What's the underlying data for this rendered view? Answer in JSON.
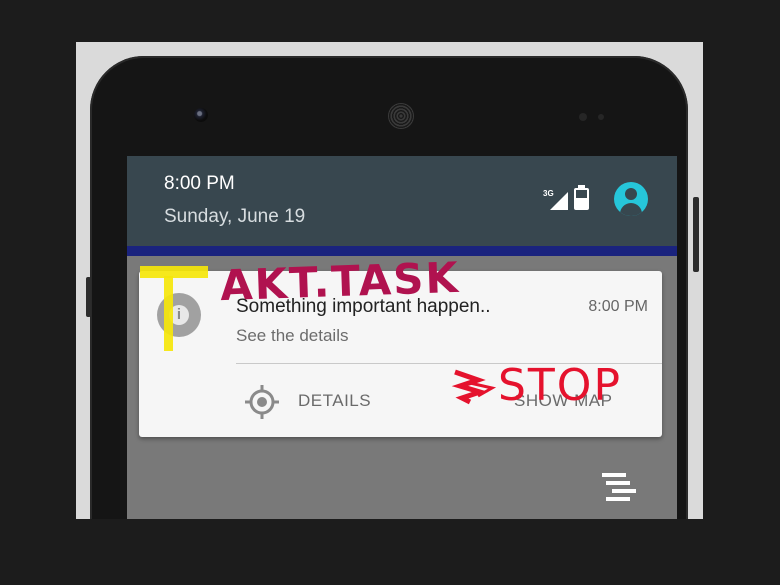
{
  "status": {
    "time": "8:00 PM",
    "date": "Sunday, June 19",
    "network": "3G",
    "icons": [
      "signal-icon",
      "battery-icon",
      "user-avatar-icon"
    ]
  },
  "notification": {
    "title": "Something important happen..",
    "time": "8:00 PM",
    "text": "See the details",
    "app_icon": "info-icon",
    "actions": [
      {
        "label": "DETAILS",
        "icon": "location-target-icon"
      },
      {
        "label": "SHOW MAP"
      }
    ]
  },
  "annotations": {
    "akt_task": "AKT.TASK",
    "stop": "STOP",
    "t_mark": "T",
    "colors": {
      "akt": "#b0124f",
      "stop": "#e5122d",
      "t": "#f5e60a"
    }
  },
  "colors": {
    "header_bg": "#38474f",
    "header_strip": "#1a237e",
    "avatar": "#26c6da",
    "card_bg": "#f6f6f6"
  }
}
